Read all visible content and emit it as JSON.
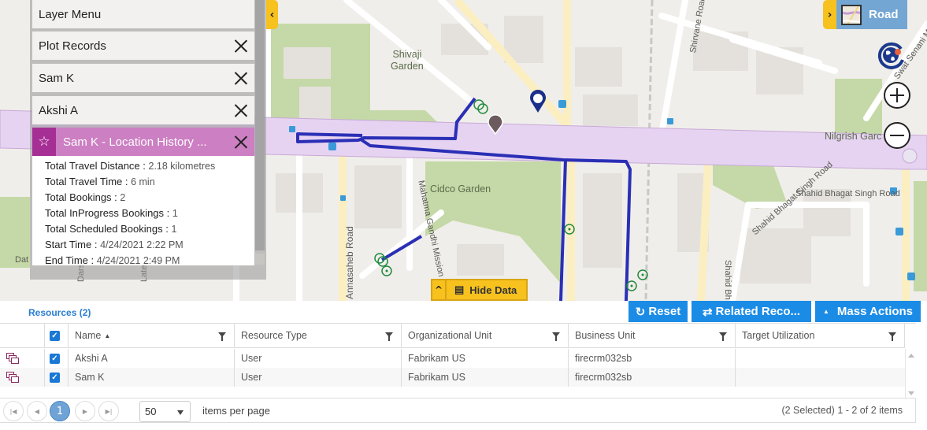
{
  "layer_menu": {
    "title": "Layer Menu",
    "layers": [
      {
        "label": "Plot Records"
      },
      {
        "label": "Sam K"
      },
      {
        "label": "Akshi A"
      }
    ],
    "active_layer": {
      "label": "Sam K - Location History ...",
      "icon": "star-icon"
    },
    "details": [
      {
        "key": "Total Travel Distance : ",
        "value": "2.18 kilometres"
      },
      {
        "key": "Total Travel Time : ",
        "value": "6 min"
      },
      {
        "key": "Total Bookings : ",
        "value": "2"
      },
      {
        "key": "Total InProgress Bookings : ",
        "value": "1"
      },
      {
        "key": "Total Scheduled Bookings : ",
        "value": "1"
      },
      {
        "key": "Start Time : ",
        "value": "4/24/2021 2:22 PM"
      },
      {
        "key": "End Time : ",
        "value": "4/24/2021 2:49 PM"
      }
    ],
    "collapse_glyph": "‹"
  },
  "map": {
    "style_toggle": {
      "label": "Road",
      "expand_glyph": "›"
    },
    "labels": {
      "shivaji_1": "Shivaji",
      "shivaji_2": "Garden",
      "cidco": "Cidco Garden",
      "nilgrish": "Nilgrish Garc",
      "bhagat": "Shahid Bhagat Singh Road",
      "bhagat_v": "Shahid Bh",
      "annasaheb": "Annasaheb Road",
      "mahatma": "Mahatma Gandhi Mission S",
      "shirvane": "Shirvane Road",
      "swat": "Swat    Senani Ma",
      "dat": "Dat",
      "dars": "Dars",
      "late": "Late"
    },
    "route_color": "#2a2fb5",
    "hide_data": {
      "label": "Hide Data",
      "up_glyph": "⌃"
    },
    "zoom_in": "+",
    "zoom_out": "−"
  },
  "grid": {
    "title": "Resources (2)",
    "buttons": {
      "reset": "Reset",
      "related": "Related Reco...",
      "mass": "Mass Actions"
    },
    "columns": [
      "Name",
      "Resource Type",
      "Organizational Unit",
      "Business Unit",
      "Target Utilization"
    ],
    "sort_indicator": "▲",
    "rows": [
      {
        "name": "Akshi A",
        "type": "User",
        "org": "Fabrikam US",
        "bu": "firecrm032sb",
        "util": "",
        "checked": true
      },
      {
        "name": "Sam K",
        "type": "User",
        "org": "Fabrikam US",
        "bu": "firecrm032sb",
        "util": "",
        "checked": true
      }
    ],
    "pager": {
      "current_page": "1",
      "page_size": "50",
      "items_per_page": "items per page",
      "info": "(2 Selected) 1 - 2 of 2 items"
    },
    "accent": "#1b8ce6"
  }
}
